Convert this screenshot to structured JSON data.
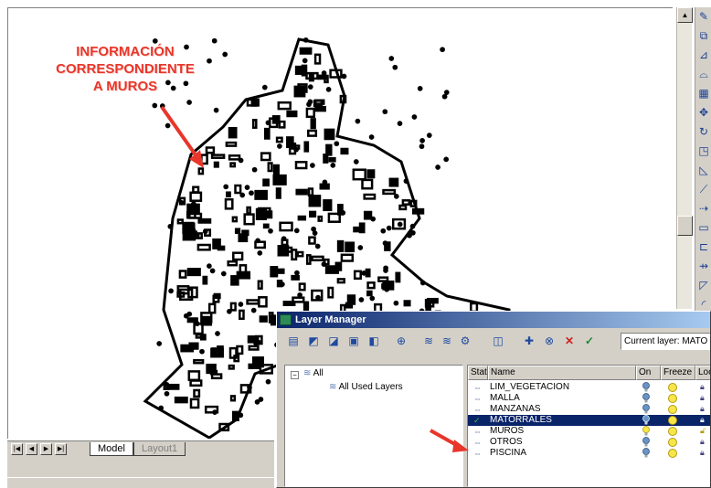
{
  "annotation": {
    "lines": [
      "INFORMACIÓN",
      "CORRESPONDIENTE",
      "A MUROS"
    ],
    "color": "#e8362a"
  },
  "tabs": {
    "model": "Model",
    "layout": "Layout1"
  },
  "right_toolbar_icons": [
    "pencil-icon",
    "copy-icon",
    "mirror-icon",
    "offset-icon",
    "array-icon",
    "move-icon",
    "rotate-icon",
    "scale-icon",
    "stretch-icon",
    "trim-icon",
    "extend-icon",
    "break-icon",
    "break-at-point-icon",
    "join-icon",
    "chamfer-icon",
    "fillet-icon"
  ],
  "layer_manager": {
    "title": "Layer Manager",
    "current_layer_label": "Current layer: MATO",
    "toolbar_icons": [
      "new-layer-icon",
      "new-group-icon",
      "open-icon",
      "save-icon",
      "restore-icon",
      "filter-icon",
      "layer-state-icon",
      "layer-state-save-icon",
      "layer-settings-icon",
      "layer-walk-icon",
      "new-layer-vp-icon",
      "delete-layer-icon",
      "delete-x-icon",
      "set-current-icon"
    ],
    "tree": {
      "root": "All",
      "child": "All Used Layers"
    },
    "columns": {
      "stat": "Stat",
      "name": "Name",
      "on": "On",
      "freeze": "Freeze",
      "lock": "Loc"
    },
    "layers": [
      {
        "name": "LIM_VEGETACION",
        "current": false
      },
      {
        "name": "MALLA",
        "current": false
      },
      {
        "name": "MANZANAS",
        "current": false
      },
      {
        "name": "MATORRALES",
        "current": true
      },
      {
        "name": "MUROS",
        "current": false
      },
      {
        "name": "OTROS",
        "current": false
      },
      {
        "name": "PISCINA",
        "current": false
      }
    ]
  },
  "colors": {
    "title_bar_start": "#0a246a",
    "title_bar_end": "#a6caf0",
    "selection": "#0a246a",
    "arrow": "#e8362a",
    "bulb_on": "#6a93c7",
    "freeze_sun": "#f6e64a"
  }
}
